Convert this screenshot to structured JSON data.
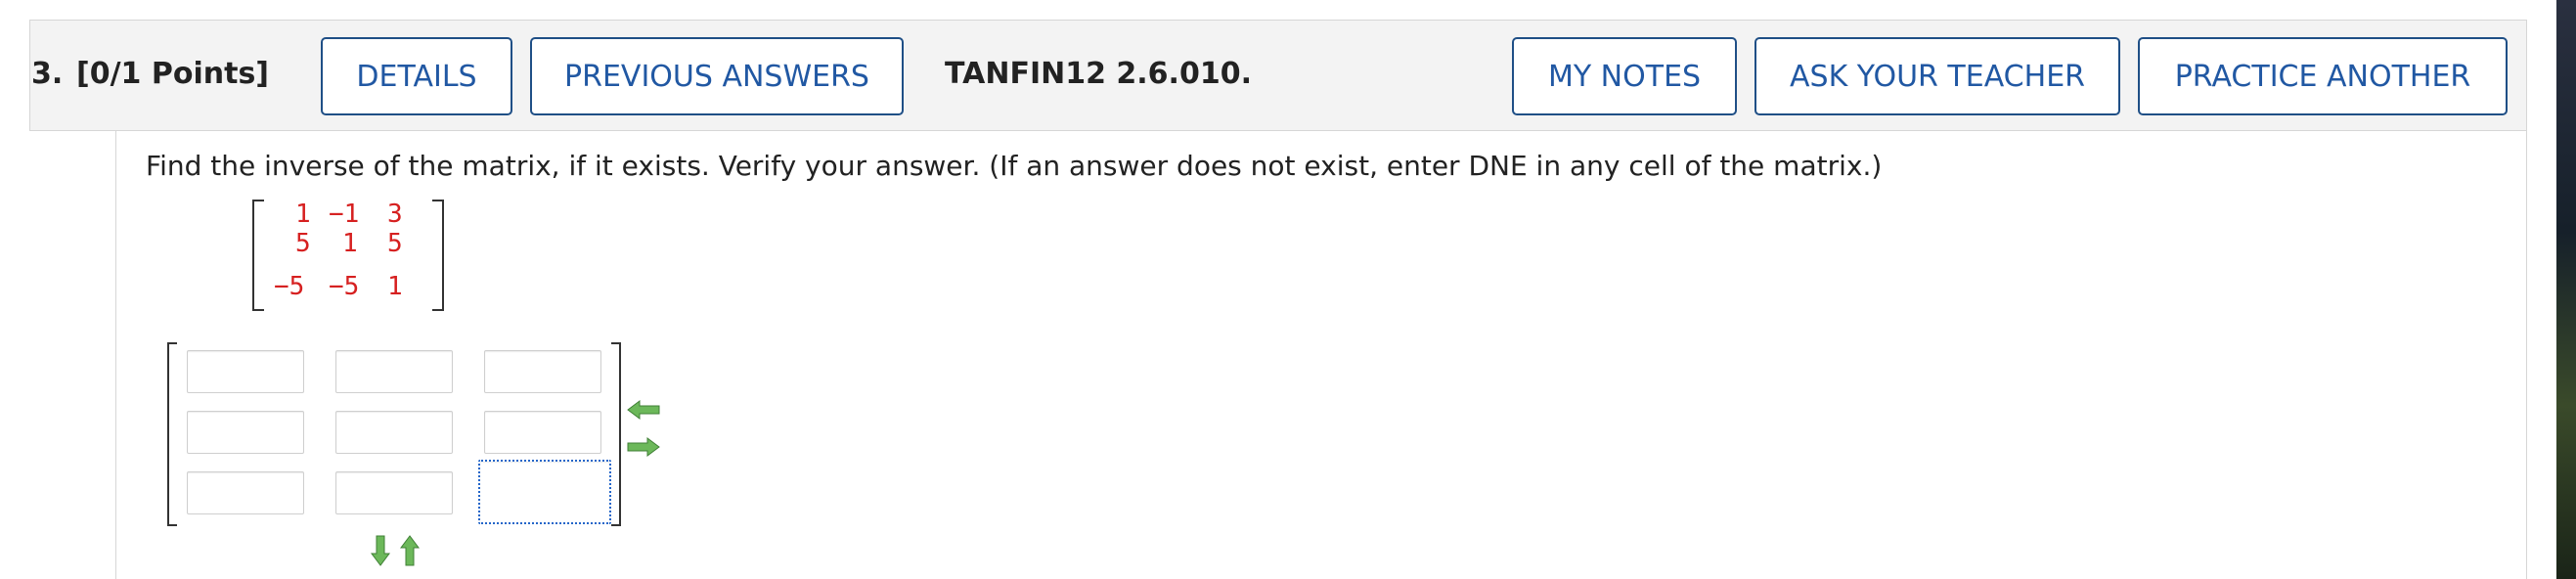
{
  "question": {
    "number": "3.",
    "points": "[0/1 Points]",
    "code": "TANFIN12 2.6.010."
  },
  "buttons": {
    "details": "DETAILS",
    "previous_answers": "PREVIOUS ANSWERS",
    "my_notes": "MY NOTES",
    "ask_teacher": "ASK YOUR TEACHER",
    "practice_another": "PRACTICE ANOTHER"
  },
  "prompt": "Find the inverse of the matrix, if it exists. Verify your answer. (If an answer does not exist, enter DNE in any cell of the matrix.)",
  "given_matrix": {
    "rows": [
      [
        "1",
        "−1",
        "3"
      ],
      [
        "5",
        "1",
        "5"
      ],
      [
        "−5",
        "−5",
        "1"
      ]
    ]
  },
  "answer_matrix": {
    "rows": [
      [
        "",
        "",
        ""
      ],
      [
        "",
        "",
        ""
      ],
      [
        "",
        "",
        ""
      ]
    ],
    "focused_cell": "2,2"
  },
  "icons": {
    "remove_column": "arrow-left-icon",
    "add_column": "arrow-right-icon",
    "add_row": "arrow-down-icon",
    "remove_row": "arrow-up-icon"
  },
  "colors": {
    "accent": "#2158a3",
    "matrix_value": "#d62020",
    "arrow_green": "#5aa84a"
  }
}
